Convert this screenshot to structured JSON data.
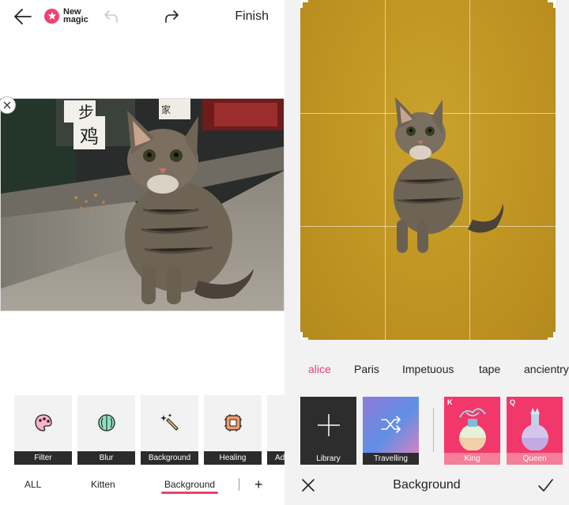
{
  "left_panel": {
    "topbar": {
      "back_icon": "arrow-left-icon",
      "brand_line1": "New",
      "brand_line2": "magic",
      "undo_icon": "undo-icon",
      "redo_icon": "redo-icon",
      "finish_label": "Finish"
    },
    "photo": {
      "subject": "cat",
      "sign_text_1": "步",
      "sign_text_2": "鸡",
      "sign_text_3": "家",
      "close_icon": "close-icon"
    },
    "tools": [
      {
        "label": "Filter",
        "icon": "palette-icon"
      },
      {
        "label": "Blur",
        "icon": "blur-ball-icon"
      },
      {
        "label": "Background",
        "icon": "magic-wand-icon"
      },
      {
        "label": "Healing",
        "icon": "bandage-icon"
      },
      {
        "label": "Ad",
        "icon": "adjust-icon"
      }
    ],
    "categories": [
      {
        "label": "ALL"
      },
      {
        "label": "Kitten"
      },
      {
        "label": "Background",
        "active": true
      }
    ],
    "add_label": "+"
  },
  "right_panel": {
    "canvas": {
      "background_color": "#c29725",
      "grid_color": "#ffffff"
    },
    "categories": [
      {
        "label": "alice",
        "active": true
      },
      {
        "label": "Paris"
      },
      {
        "label": "Impetuous"
      },
      {
        "label": "tape"
      },
      {
        "label": "ancientry"
      }
    ],
    "thumbs": [
      {
        "label": "Library",
        "icon": "plus-icon"
      },
      {
        "label": "Travelling",
        "icon": "shuffle-icon"
      },
      {
        "label": "King",
        "card_letter": "K"
      },
      {
        "label": "Queen",
        "card_letter": "Q"
      }
    ],
    "bottom": {
      "cancel_icon": "close-icon",
      "title": "Background",
      "confirm_icon": "check-icon"
    }
  },
  "colors": {
    "accent": "#f0416f",
    "tool_label_bg": "#2b2b2b",
    "thumb_pink": "#f2386a"
  }
}
